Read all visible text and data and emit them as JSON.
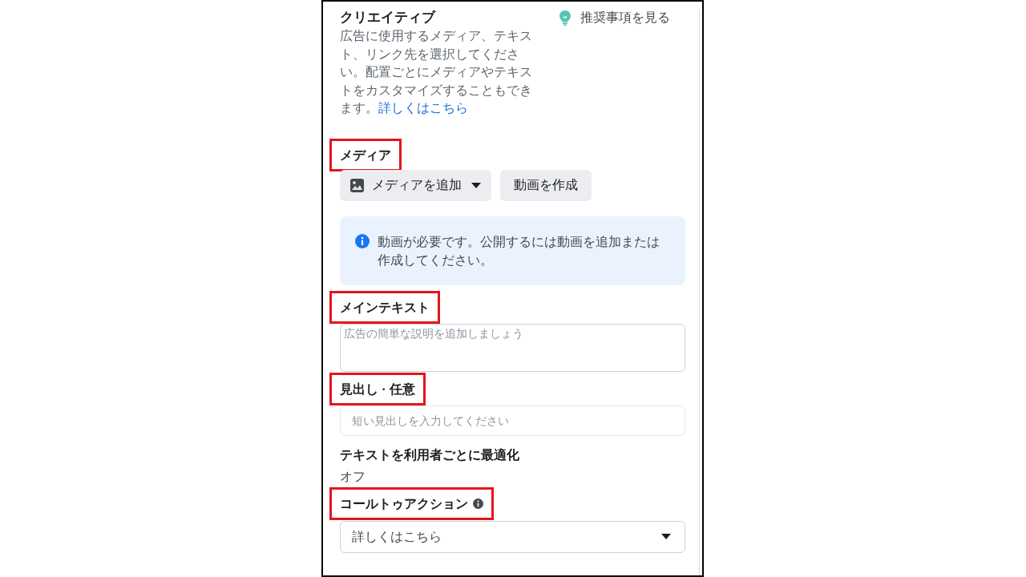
{
  "creative": {
    "title": "クリエイティブ",
    "description": "広告に使用するメディア、テキスト、リンク先を選択してください。配置ごとにメディアやテキストをカスタマイズすることもできます。",
    "learn_more_link": "詳しくはこちら",
    "recommendations_link": "推奨事項を見る"
  },
  "sections": [
    {
      "kind": "media",
      "label": "メディア",
      "highlighted": true,
      "info_icon": false,
      "buttons": [
        {
          "kind": "dropdown",
          "label": "メディアを追加"
        },
        {
          "kind": "plain",
          "label": "動画を作成"
        }
      ],
      "notice": "動画が必要です。公開するには動画を追加または作成してください。"
    },
    {
      "kind": "textarea",
      "label": "メインテキスト",
      "highlighted": true,
      "info_icon": false,
      "placeholder": "広告の簡単な説明を追加しましょう"
    },
    {
      "kind": "input",
      "label": "見出し · 任意",
      "highlighted": true,
      "info_icon": false,
      "placeholder": "短い見出しを入力してください"
    },
    {
      "kind": "setting",
      "label": "テキストを利用者ごとに最適化",
      "highlighted": false,
      "info_icon": false,
      "value": "オフ"
    },
    {
      "kind": "select",
      "label": "コールトゥアクション",
      "highlighted": true,
      "info_icon": true,
      "value": "詳しくはこちら"
    }
  ]
}
